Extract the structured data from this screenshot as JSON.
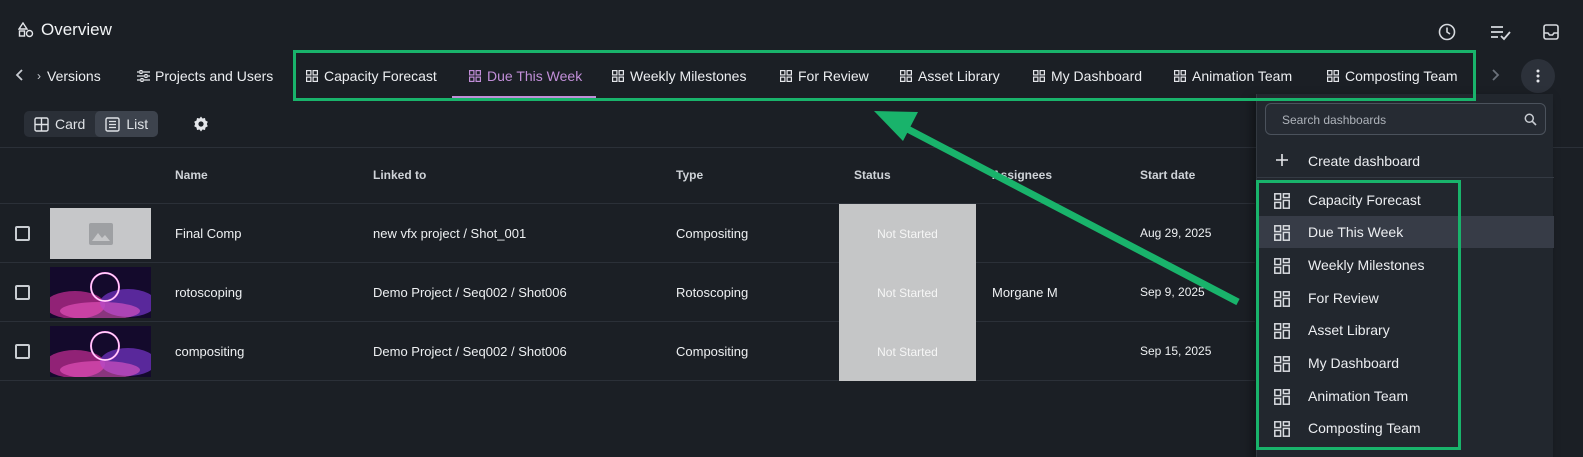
{
  "app": {
    "title": "Overview"
  },
  "tabs": [
    {
      "label": "Versions",
      "active": false
    },
    {
      "label": "Projects and Users",
      "active": false
    },
    {
      "label": "Capacity Forecast",
      "active": false
    },
    {
      "label": "Due This Week",
      "active": true
    },
    {
      "label": "Weekly Milestones",
      "active": false
    },
    {
      "label": "For Review",
      "active": false
    },
    {
      "label": "Asset Library",
      "active": false
    },
    {
      "label": "My Dashboard",
      "active": false
    },
    {
      "label": "Animation Team",
      "active": false
    },
    {
      "label": "Composting Team",
      "active": false
    }
  ],
  "view_toggle": {
    "card_label": "Card",
    "list_label": "List",
    "selected": "List"
  },
  "table": {
    "headers": {
      "name": "Name",
      "linked_to": "Linked to",
      "type": "Type",
      "status": "Status",
      "assignees": "Assignees",
      "start_date": "Start date"
    },
    "rows": [
      {
        "name": "Final Comp",
        "linked_to": "new vfx project / Shot_001",
        "type": "Compositing",
        "status": "Not Started",
        "assignees": "",
        "start_date": "Aug 29, 2025",
        "thumb": "placeholder"
      },
      {
        "name": "rotoscoping",
        "linked_to": "Demo Project / Seq002 / Shot006",
        "type": "Rotoscoping",
        "status": "Not Started",
        "assignees": "Morgane M",
        "start_date": "Sep 9, 2025",
        "thumb": "neon"
      },
      {
        "name": "compositing",
        "linked_to": "Demo Project / Seq002 / Shot006",
        "type": "Compositing",
        "status": "Not Started",
        "assignees": "",
        "start_date": "Sep 15, 2025",
        "thumb": "neon"
      }
    ]
  },
  "dropdown": {
    "search_placeholder": "Search dashboards",
    "create_label": "Create dashboard",
    "items": [
      {
        "label": "Capacity Forecast",
        "active": false
      },
      {
        "label": "Due This Week",
        "active": true
      },
      {
        "label": "Weekly Milestones",
        "active": false
      },
      {
        "label": "For Review",
        "active": false
      },
      {
        "label": "Asset Library",
        "active": false
      },
      {
        "label": "My Dashboard",
        "active": false
      },
      {
        "label": "Animation Team",
        "active": false
      },
      {
        "label": "Composting Team",
        "active": false
      }
    ]
  },
  "colors": {
    "accent_active": "#c18ed8",
    "highlight": "#19b36b",
    "background": "#1b1f25",
    "status_bg": "#c5c6c7"
  }
}
